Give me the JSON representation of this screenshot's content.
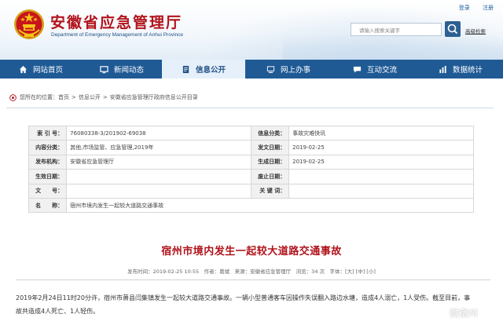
{
  "header": {
    "title": "安徽省应急管理厅",
    "subtitle": "Department of Emergency Management of Anhui Province",
    "links": [
      "登录",
      "注册"
    ],
    "search_placeholder": "请输入搜索关键字",
    "advanced_search": "高级检索"
  },
  "nav": {
    "items": [
      {
        "label": "网站首页",
        "icon": "home-icon"
      },
      {
        "label": "新闻动态",
        "icon": "monitor-icon"
      },
      {
        "label": "信息公开",
        "icon": "document-icon"
      },
      {
        "label": "网上办事",
        "icon": "computer-icon"
      },
      {
        "label": "互动交流",
        "icon": "chat-icon"
      },
      {
        "label": "数据统计",
        "icon": "chart-icon"
      }
    ],
    "active_index": 2
  },
  "breadcrumb": {
    "prefix": "您所在的位置：",
    "items": [
      "首页",
      "信息公开",
      "安徽省应急管理厅政府信息公开目录"
    ]
  },
  "info": {
    "rows": [
      [
        {
          "k": "索 引 号：",
          "v": "76080338-3/201902-69038"
        },
        {
          "k": "信息分类：",
          "v": "事故灾难快讯"
        }
      ],
      [
        {
          "k": "内容分类：",
          "v": "其他,市场监管、应急管理,2019年"
        },
        {
          "k": "发文日期：",
          "v": "2019-02-25"
        }
      ],
      [
        {
          "k": "发布机构：",
          "v": "安徽省应急管理厅"
        },
        {
          "k": "生成日期：",
          "v": "2019-02-25"
        }
      ],
      [
        {
          "k": "生效日期：",
          "v": ""
        },
        {
          "k": "废止日期：",
          "v": ""
        }
      ],
      [
        {
          "k": "文　　号：",
          "v": ""
        },
        {
          "k": "关 键 词：",
          "v": ""
        }
      ]
    ],
    "name_label": "名　　称：",
    "name_value": "宿州市境内发生一起较大道路交通事故"
  },
  "article": {
    "title": "宿州市境内发生一起较大道路交通事故",
    "meta": "发布时间：2019-02-25 10:55　作者：葛斌　来源：安徽省应急管理厅　浏览：34 次　字体：[大] [中] [小]",
    "body": "2019年2月24日11时20分许，宿州市萧县闫集镇发生一起较大道路交通事故。一辆小型普通客车因操作失误翻入路边水塘，造成4人溺亡，1人受伤。截至目前，事故共造成4人死亡、1人轻伤。"
  },
  "watermark": "微宿州",
  "colors": {
    "brand_red": "#b1131b",
    "nav_blue": "#1f5a95",
    "active_tab": "#e5f0fa"
  }
}
